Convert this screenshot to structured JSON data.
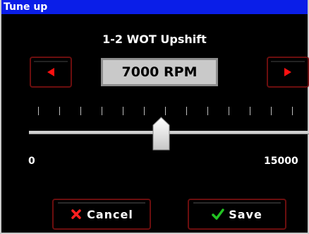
{
  "window": {
    "title": "Tune up"
  },
  "parameter": {
    "name": "1-2 WOT Upshift",
    "value_display": "7000 RPM",
    "value": 7000,
    "unit": "RPM"
  },
  "slider": {
    "min_label": "0",
    "max_label": "15000",
    "min": 0,
    "max": 15000,
    "value": 7000,
    "tick_count": 13
  },
  "buttons": {
    "decrement_icon": "left-triangle-icon",
    "increment_icon": "right-triangle-icon",
    "cancel_label": "Cancel",
    "cancel_icon": "x-icon",
    "save_label": "Save",
    "save_icon": "checkmark-icon"
  },
  "colors": {
    "titlebar": "#0a1ee8",
    "arrow": "#ff1010",
    "cancel_icon": "#ff2020",
    "save_icon": "#22c322",
    "button_border": "#6b0e0e",
    "value_box_bg": "#c9c9c9"
  }
}
